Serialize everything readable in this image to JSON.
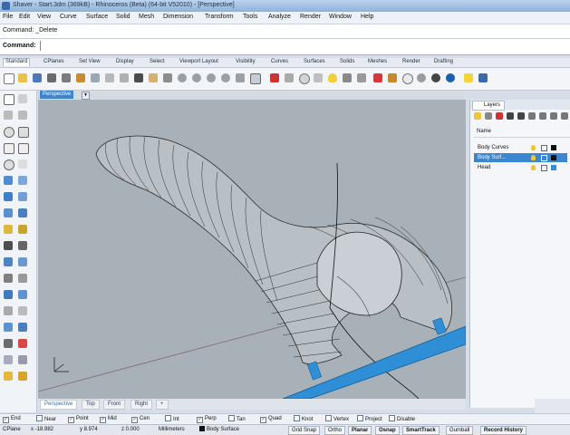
{
  "window": {
    "title": "Shaver - Start.3dm (369kB) - Rhinoceros (Beta) (64-bit V52010) - [Perspective]"
  },
  "menu": [
    "File",
    "Edit",
    "View",
    "Curve",
    "Surface",
    "Solid",
    "Mesh",
    "Dimension",
    "Transform",
    "Tools",
    "Analyze",
    "Render",
    "Window",
    "Help"
  ],
  "command": {
    "history": "Command: _Delete",
    "prompt": "Command:",
    "value": ""
  },
  "toolbar_tabs": [
    "Standard",
    "CPlanes",
    "Set View",
    "Display",
    "Select",
    "Viewport Layout",
    "Visibility",
    "Curves",
    "Surfaces",
    "Solids",
    "Meshes",
    "Render",
    "Drafting"
  ],
  "viewport": {
    "title": "Perspective",
    "tabs": [
      "Perspective",
      "Top",
      "Front",
      "Right"
    ]
  },
  "layers": {
    "tab": "Layers",
    "column": "Name",
    "rows": [
      {
        "name": "Body Curves",
        "color": "#111111",
        "selected": false
      },
      {
        "name": "Body Surf...",
        "color": "#111111",
        "selected": true
      },
      {
        "name": "Head",
        "color": "#2f8fd6",
        "selected": false
      }
    ]
  },
  "osnaps": [
    {
      "label": "End",
      "checked": true
    },
    {
      "label": "Near",
      "checked": false
    },
    {
      "label": "Point",
      "checked": true
    },
    {
      "label": "Mid",
      "checked": true
    },
    {
      "label": "Cen",
      "checked": true
    },
    {
      "label": "Int",
      "checked": false
    },
    {
      "label": "Perp",
      "checked": true
    },
    {
      "label": "Tan",
      "checked": false
    },
    {
      "label": "Quad",
      "checked": true
    },
    {
      "label": "Knot",
      "checked": false
    },
    {
      "label": "Vertex",
      "checked": false
    },
    {
      "label": "Project",
      "checked": false
    },
    {
      "label": "Disable",
      "checked": false
    }
  ],
  "status": {
    "cplane": "CPlane",
    "x": "x -18.982",
    "y": "y 8.974",
    "z": "z 0.000",
    "units": "Millimeters",
    "layer": "Body Surface",
    "panes": [
      "Grid Snap",
      "Ortho",
      "Planar",
      "Osnap",
      "SmartTrack",
      "Gumball",
      "Record History"
    ]
  },
  "colors": {
    "accent": "#3a86d0",
    "viewport_bg": "#a9b1b8",
    "tube": "#2e8fd6"
  }
}
